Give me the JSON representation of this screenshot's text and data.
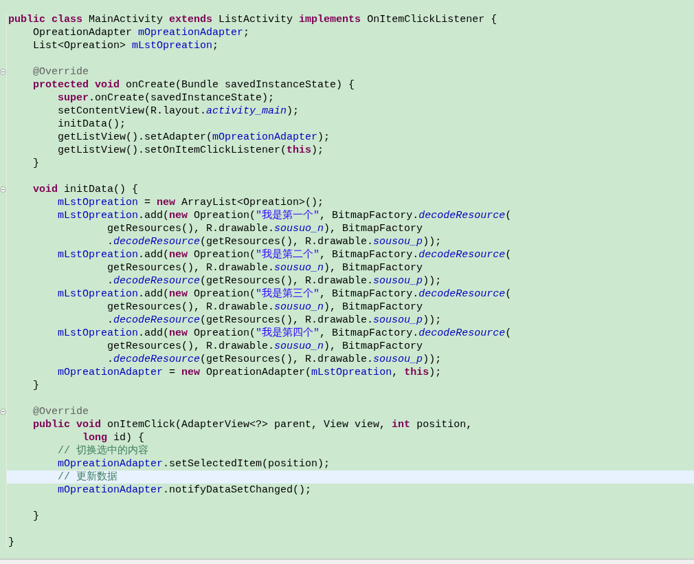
{
  "editor": {
    "lines": [
      {
        "current": false,
        "fold": false,
        "segments": [
          {
            "kind": "keyword",
            "text": "public class"
          },
          {
            "kind": "plain",
            "text": " MainActivity "
          },
          {
            "kind": "keyword",
            "text": "extends"
          },
          {
            "kind": "plain",
            "text": " ListActivity "
          },
          {
            "kind": "keyword",
            "text": "implements"
          },
          {
            "kind": "plain",
            "text": " OnItemClickListener {"
          }
        ]
      },
      {
        "current": false,
        "fold": false,
        "segments": [
          {
            "kind": "plain",
            "text": "    OpreationAdapter "
          },
          {
            "kind": "field",
            "text": "mOpreationAdapter"
          },
          {
            "kind": "plain",
            "text": ";"
          }
        ]
      },
      {
        "current": false,
        "fold": false,
        "segments": [
          {
            "kind": "plain",
            "text": "    List<Opreation> "
          },
          {
            "kind": "field",
            "text": "mLstOpreation"
          },
          {
            "kind": "plain",
            "text": ";"
          }
        ]
      },
      {
        "current": false,
        "fold": false
      },
      {
        "current": false,
        "fold": true,
        "segments": [
          {
            "kind": "annotation",
            "text": "    @Override"
          }
        ]
      },
      {
        "current": false,
        "fold": false,
        "segments": [
          {
            "kind": "keyword",
            "text": "    protected void"
          },
          {
            "kind": "plain",
            "text": " onCreate(Bundle savedInstanceState) {"
          }
        ]
      },
      {
        "current": false,
        "fold": false,
        "segments": [
          {
            "kind": "keyword",
            "text": "        super"
          },
          {
            "kind": "plain",
            "text": ".onCreate(savedInstanceState);"
          }
        ]
      },
      {
        "current": false,
        "fold": false,
        "segments": [
          {
            "kind": "plain",
            "text": "        setContentView(R.layout."
          },
          {
            "kind": "static",
            "text": "activity_main"
          },
          {
            "kind": "plain",
            "text": ");"
          }
        ]
      },
      {
        "current": false,
        "fold": false,
        "segments": [
          {
            "kind": "plain",
            "text": "        initData();"
          }
        ]
      },
      {
        "current": false,
        "fold": false,
        "segments": [
          {
            "kind": "plain",
            "text": "        getListView().setAdapter("
          },
          {
            "kind": "field",
            "text": "mOpreationAdapter"
          },
          {
            "kind": "plain",
            "text": ");"
          }
        ]
      },
      {
        "current": false,
        "fold": false,
        "segments": [
          {
            "kind": "plain",
            "text": "        getListView().setOnItemClickListener("
          },
          {
            "kind": "keyword",
            "text": "this"
          },
          {
            "kind": "plain",
            "text": ");"
          }
        ]
      },
      {
        "current": false,
        "fold": false,
        "segments": [
          {
            "kind": "plain",
            "text": "    }"
          }
        ]
      },
      {
        "current": false,
        "fold": false
      },
      {
        "current": false,
        "fold": true,
        "segments": [
          {
            "kind": "keyword",
            "text": "    void"
          },
          {
            "kind": "plain",
            "text": " initData() {"
          }
        ]
      },
      {
        "current": false,
        "fold": false,
        "segments": [
          {
            "kind": "field",
            "text": "        mLstOpreation"
          },
          {
            "kind": "plain",
            "text": " = "
          },
          {
            "kind": "keyword",
            "text": "new"
          },
          {
            "kind": "plain",
            "text": " ArrayList<Opreation>();"
          }
        ]
      },
      {
        "current": false,
        "fold": false,
        "segments": [
          {
            "kind": "field",
            "text": "        mLstOpreation"
          },
          {
            "kind": "plain",
            "text": ".add("
          },
          {
            "kind": "keyword",
            "text": "new"
          },
          {
            "kind": "plain",
            "text": " Opreation("
          },
          {
            "kind": "string",
            "text": "\"我是第一个\""
          },
          {
            "kind": "plain",
            "text": ", BitmapFactory."
          },
          {
            "kind": "static",
            "text": "decodeResource"
          },
          {
            "kind": "plain",
            "text": "("
          }
        ]
      },
      {
        "current": false,
        "fold": false,
        "segments": [
          {
            "kind": "plain",
            "text": "                getResources(), R.drawable."
          },
          {
            "kind": "static",
            "text": "sousuo_n"
          },
          {
            "kind": "plain",
            "text": "), BitmapFactory"
          }
        ]
      },
      {
        "current": false,
        "fold": false,
        "segments": [
          {
            "kind": "plain",
            "text": "                ."
          },
          {
            "kind": "static",
            "text": "decodeResource"
          },
          {
            "kind": "plain",
            "text": "(getResources(), R.drawable."
          },
          {
            "kind": "static",
            "text": "sousou_p"
          },
          {
            "kind": "plain",
            "text": "));"
          }
        ]
      },
      {
        "current": false,
        "fold": false,
        "segments": [
          {
            "kind": "field",
            "text": "        mLstOpreation"
          },
          {
            "kind": "plain",
            "text": ".add("
          },
          {
            "kind": "keyword",
            "text": "new"
          },
          {
            "kind": "plain",
            "text": " Opreation("
          },
          {
            "kind": "string",
            "text": "\"我是第二个\""
          },
          {
            "kind": "plain",
            "text": ", BitmapFactory."
          },
          {
            "kind": "static",
            "text": "decodeResource"
          },
          {
            "kind": "plain",
            "text": "("
          }
        ]
      },
      {
        "current": false,
        "fold": false,
        "segments": [
          {
            "kind": "plain",
            "text": "                getResources(), R.drawable."
          },
          {
            "kind": "static",
            "text": "sousuo_n"
          },
          {
            "kind": "plain",
            "text": "), BitmapFactory"
          }
        ]
      },
      {
        "current": false,
        "fold": false,
        "segments": [
          {
            "kind": "plain",
            "text": "                ."
          },
          {
            "kind": "static",
            "text": "decodeResource"
          },
          {
            "kind": "plain",
            "text": "(getResources(), R.drawable."
          },
          {
            "kind": "static",
            "text": "sousou_p"
          },
          {
            "kind": "plain",
            "text": "));"
          }
        ]
      },
      {
        "current": false,
        "fold": false,
        "segments": [
          {
            "kind": "field",
            "text": "        mLstOpreation"
          },
          {
            "kind": "plain",
            "text": ".add("
          },
          {
            "kind": "keyword",
            "text": "new"
          },
          {
            "kind": "plain",
            "text": " Opreation("
          },
          {
            "kind": "string",
            "text": "\"我是第三个\""
          },
          {
            "kind": "plain",
            "text": ", BitmapFactory."
          },
          {
            "kind": "static",
            "text": "decodeResource"
          },
          {
            "kind": "plain",
            "text": "("
          }
        ]
      },
      {
        "current": false,
        "fold": false,
        "segments": [
          {
            "kind": "plain",
            "text": "                getResources(), R.drawable."
          },
          {
            "kind": "static",
            "text": "sousuo_n"
          },
          {
            "kind": "plain",
            "text": "), BitmapFactory"
          }
        ]
      },
      {
        "current": false,
        "fold": false,
        "segments": [
          {
            "kind": "plain",
            "text": "                ."
          },
          {
            "kind": "static",
            "text": "decodeResource"
          },
          {
            "kind": "plain",
            "text": "(getResources(), R.drawable."
          },
          {
            "kind": "static",
            "text": "sousou_p"
          },
          {
            "kind": "plain",
            "text": "));"
          }
        ]
      },
      {
        "current": false,
        "fold": false,
        "segments": [
          {
            "kind": "field",
            "text": "        mLstOpreation"
          },
          {
            "kind": "plain",
            "text": ".add("
          },
          {
            "kind": "keyword",
            "text": "new"
          },
          {
            "kind": "plain",
            "text": " Opreation("
          },
          {
            "kind": "string",
            "text": "\"我是第四个\""
          },
          {
            "kind": "plain",
            "text": ", BitmapFactory."
          },
          {
            "kind": "static",
            "text": "decodeResource"
          },
          {
            "kind": "plain",
            "text": "("
          }
        ]
      },
      {
        "current": false,
        "fold": false,
        "segments": [
          {
            "kind": "plain",
            "text": "                getResources(), R.drawable."
          },
          {
            "kind": "static",
            "text": "sousuo_n"
          },
          {
            "kind": "plain",
            "text": "), BitmapFactory"
          }
        ]
      },
      {
        "current": false,
        "fold": false,
        "segments": [
          {
            "kind": "plain",
            "text": "                ."
          },
          {
            "kind": "static",
            "text": "decodeResource"
          },
          {
            "kind": "plain",
            "text": "(getResources(), R.drawable."
          },
          {
            "kind": "static",
            "text": "sousou_p"
          },
          {
            "kind": "plain",
            "text": "));"
          }
        ]
      },
      {
        "current": false,
        "fold": false,
        "segments": [
          {
            "kind": "field",
            "text": "        mOpreationAdapter"
          },
          {
            "kind": "plain",
            "text": " = "
          },
          {
            "kind": "keyword",
            "text": "new"
          },
          {
            "kind": "plain",
            "text": " OpreationAdapter("
          },
          {
            "kind": "field",
            "text": "mLstOpreation"
          },
          {
            "kind": "plain",
            "text": ", "
          },
          {
            "kind": "keyword",
            "text": "this"
          },
          {
            "kind": "plain",
            "text": ");"
          }
        ]
      },
      {
        "current": false,
        "fold": false,
        "segments": [
          {
            "kind": "plain",
            "text": "    }"
          }
        ]
      },
      {
        "current": false,
        "fold": false
      },
      {
        "current": false,
        "fold": true,
        "segments": [
          {
            "kind": "annotation",
            "text": "    @Override"
          }
        ]
      },
      {
        "current": false,
        "fold": false,
        "segments": [
          {
            "kind": "keyword",
            "text": "    public void"
          },
          {
            "kind": "plain",
            "text": " onItemClick(AdapterView<?> parent, View view, "
          },
          {
            "kind": "keyword",
            "text": "int"
          },
          {
            "kind": "plain",
            "text": " position,"
          }
        ]
      },
      {
        "current": false,
        "fold": false,
        "segments": [
          {
            "kind": "keyword",
            "text": "            long"
          },
          {
            "kind": "plain",
            "text": " id) {"
          }
        ]
      },
      {
        "current": false,
        "fold": false,
        "segments": [
          {
            "kind": "comment",
            "text": "        // 切换选中的内容"
          }
        ]
      },
      {
        "current": false,
        "fold": false,
        "segments": [
          {
            "kind": "field",
            "text": "        mOpreationAdapter"
          },
          {
            "kind": "plain",
            "text": ".setSelectedItem(position);"
          }
        ]
      },
      {
        "current": true,
        "fold": false,
        "segments": [
          {
            "kind": "comment",
            "text": "        // 更新数据"
          }
        ]
      },
      {
        "current": false,
        "fold": false,
        "segments": [
          {
            "kind": "field",
            "text": "        mOpreationAdapter"
          },
          {
            "kind": "plain",
            "text": ".notifyDataSetChanged();"
          }
        ]
      },
      {
        "current": false,
        "fold": false
      },
      {
        "current": false,
        "fold": false,
        "segments": [
          {
            "kind": "plain",
            "text": "    }"
          }
        ]
      },
      {
        "current": false,
        "fold": false
      },
      {
        "current": false,
        "fold": false,
        "segments": [
          {
            "kind": "plain",
            "text": "}"
          }
        ]
      }
    ]
  }
}
